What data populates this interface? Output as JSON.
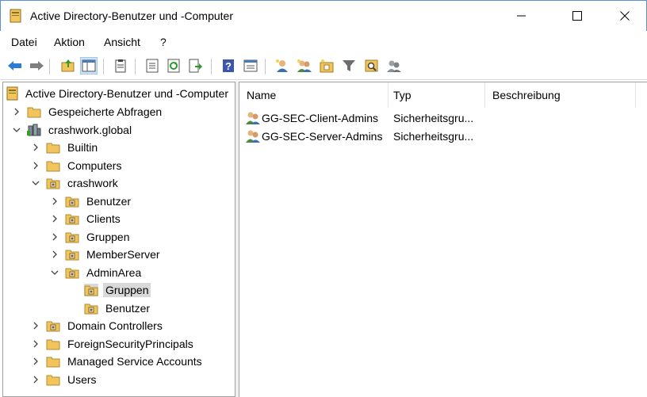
{
  "window": {
    "title": "Active Directory-Benutzer und -Computer",
    "colors": {
      "accent": "#2b7bd1",
      "folder": "#f2c55c",
      "selection": "#d9d9d9"
    }
  },
  "menu": [
    "Datei",
    "Aktion",
    "Ansicht",
    "?"
  ],
  "toolbar": {
    "icons": [
      "back-arrow-icon",
      "forward-arrow-icon",
      "up-folder-icon",
      "show-hide-tree-icon",
      "clipboard-icon",
      "properties-icon",
      "refresh-icon",
      "export-list-icon",
      "help-icon",
      "console-view-icon",
      "new-user-icon",
      "new-group-icon",
      "new-ou-icon",
      "filter-icon",
      "find-icon",
      "add-to-group-icon"
    ]
  },
  "tree": {
    "root": "Active Directory-Benutzer und -Computer",
    "items": [
      {
        "label": "Gespeicherte Abfragen",
        "depth": 1,
        "expander": "collapsed",
        "icon": "folder"
      },
      {
        "label": "crashwork.global",
        "depth": 1,
        "expander": "expanded",
        "icon": "domain"
      },
      {
        "label": "Builtin",
        "depth": 2,
        "expander": "collapsed",
        "icon": "folder"
      },
      {
        "label": "Computers",
        "depth": 2,
        "expander": "collapsed",
        "icon": "folder"
      },
      {
        "label": "crashwork",
        "depth": 2,
        "expander": "expanded",
        "icon": "ou"
      },
      {
        "label": "Benutzer",
        "depth": 3,
        "expander": "collapsed",
        "icon": "ou"
      },
      {
        "label": "Clients",
        "depth": 3,
        "expander": "collapsed",
        "icon": "ou"
      },
      {
        "label": "Gruppen",
        "depth": 3,
        "expander": "collapsed",
        "icon": "ou"
      },
      {
        "label": "MemberServer",
        "depth": 3,
        "expander": "collapsed",
        "icon": "ou"
      },
      {
        "label": "AdminArea",
        "depth": 3,
        "expander": "expanded",
        "icon": "ou"
      },
      {
        "label": "Gruppen",
        "depth": 4,
        "expander": "none",
        "icon": "ou",
        "selected": true
      },
      {
        "label": "Benutzer",
        "depth": 4,
        "expander": "none",
        "icon": "ou"
      },
      {
        "label": "Domain Controllers",
        "depth": 2,
        "expander": "collapsed",
        "icon": "ou"
      },
      {
        "label": "ForeignSecurityPrincipals",
        "depth": 2,
        "expander": "collapsed",
        "icon": "folder"
      },
      {
        "label": "Managed Service Accounts",
        "depth": 2,
        "expander": "collapsed",
        "icon": "folder"
      },
      {
        "label": "Users",
        "depth": 2,
        "expander": "collapsed",
        "icon": "folder"
      }
    ]
  },
  "list": {
    "columns": [
      "Name",
      "Typ",
      "Beschreibung"
    ],
    "rows": [
      {
        "name": "GG-SEC-Client-Admins",
        "type": "Sicherheitsgru..."
      },
      {
        "name": "GG-SEC-Server-Admins",
        "type": "Sicherheitsgru..."
      }
    ]
  }
}
